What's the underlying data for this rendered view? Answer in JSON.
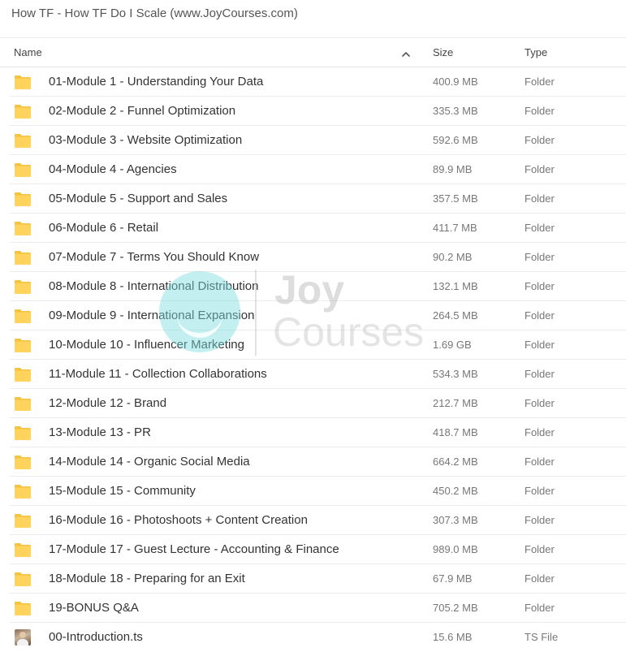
{
  "breadcrumb": "How TF - How TF Do I Scale (www.JoyCourses.com)",
  "columns": {
    "name": "Name",
    "size": "Size",
    "type": "Type",
    "sort_icon": "chevron-up-icon"
  },
  "colors": {
    "folder": "#ffd35c",
    "folder_dark": "#f5c342",
    "divider": "#ebebeb",
    "text": "#333333",
    "muted": "#777777"
  },
  "files": [
    {
      "name": "01-Module 1 - Understanding Your Data",
      "size": "400.9 MB",
      "type": "Folder",
      "icon": "folder-icon"
    },
    {
      "name": "02-Module 2 - Funnel Optimization",
      "size": "335.3 MB",
      "type": "Folder",
      "icon": "folder-icon"
    },
    {
      "name": "03-Module 3 - Website Optimization",
      "size": "592.6 MB",
      "type": "Folder",
      "icon": "folder-icon"
    },
    {
      "name": "04-Module 4 - Agencies",
      "size": "89.9 MB",
      "type": "Folder",
      "icon": "folder-icon"
    },
    {
      "name": "05-Module 5 - Support and Sales",
      "size": "357.5 MB",
      "type": "Folder",
      "icon": "folder-icon"
    },
    {
      "name": "06-Module 6 - Retail",
      "size": "411.7 MB",
      "type": "Folder",
      "icon": "folder-icon"
    },
    {
      "name": "07-Module 7 - Terms You Should Know",
      "size": "90.2 MB",
      "type": "Folder",
      "icon": "folder-icon"
    },
    {
      "name": "08-Module 8 - International Distribution",
      "size": "132.1 MB",
      "type": "Folder",
      "icon": "folder-icon"
    },
    {
      "name": "09-Module 9 - International Expansion",
      "size": "264.5 MB",
      "type": "Folder",
      "icon": "folder-icon"
    },
    {
      "name": "10-Module 10 - Influencer Marketing",
      "size": "1.69 GB",
      "type": "Folder",
      "icon": "folder-icon"
    },
    {
      "name": "11-Module 11 - Collection Collaborations",
      "size": "534.3 MB",
      "type": "Folder",
      "icon": "folder-icon"
    },
    {
      "name": "12-Module 12 - Brand",
      "size": "212.7 MB",
      "type": "Folder",
      "icon": "folder-icon"
    },
    {
      "name": "13-Module 13 - PR",
      "size": "418.7 MB",
      "type": "Folder",
      "icon": "folder-icon"
    },
    {
      "name": "14-Module 14 - Organic Social Media",
      "size": "664.2 MB",
      "type": "Folder",
      "icon": "folder-icon"
    },
    {
      "name": "15-Module 15 - Community",
      "size": "450.2 MB",
      "type": "Folder",
      "icon": "folder-icon"
    },
    {
      "name": "16-Module 16 - Photoshoots + Content Creation",
      "size": "307.3 MB",
      "type": "Folder",
      "icon": "folder-icon"
    },
    {
      "name": "17-Module 17 - Guest Lecture - Accounting & Finance",
      "size": "989.0 MB",
      "type": "Folder",
      "icon": "folder-icon"
    },
    {
      "name": "18-Module 18 - Preparing for an Exit",
      "size": "67.9 MB",
      "type": "Folder",
      "icon": "folder-icon"
    },
    {
      "name": "19-BONUS Q&A",
      "size": "705.2 MB",
      "type": "Folder",
      "icon": "folder-icon"
    },
    {
      "name": "00-Introduction.ts",
      "size": "15.6 MB",
      "type": "TS File",
      "icon": "video-thumbnail-icon"
    }
  ],
  "watermark": {
    "line1": "Joy",
    "line2": "Courses"
  }
}
